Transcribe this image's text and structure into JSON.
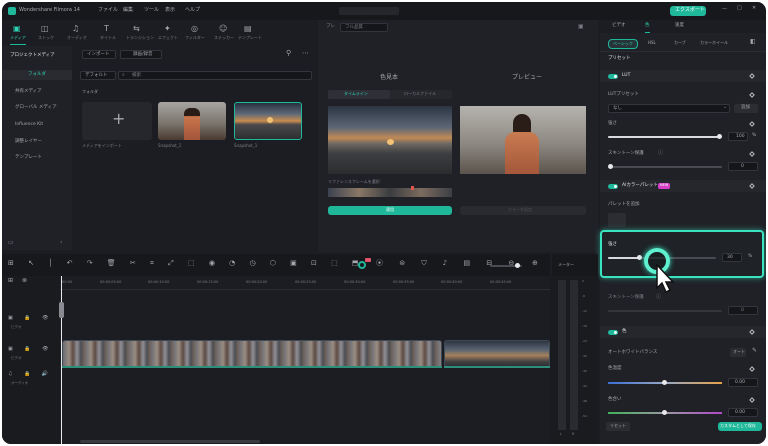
{
  "app": {
    "title": "Wondershare Filmora 14"
  },
  "menu": [
    "ファイル",
    "編集",
    "ツール",
    "表示",
    "ヘルプ"
  ],
  "export_label": "エクスポート",
  "toolbar": [
    "メディア",
    "ストック",
    "オーディオ",
    "タイトル",
    "トランジション",
    "エフェクト",
    "フィルター",
    "ステッカー",
    "テンプレート"
  ],
  "sidebar": {
    "items": [
      "プロジェクトメディア",
      "フォルダ",
      "共有メディア",
      "グローバル メディア",
      "Influence Kit",
      "調整レイヤー",
      "テンプレート"
    ]
  },
  "media": {
    "import_label": "インポート",
    "record_label": "録画/録音",
    "sort_label": "デフォルト",
    "search_placeholder": "検索",
    "folder_label": "フォルダ",
    "import_tile_label": "メディアをインポート",
    "thumbs": [
      "Snapshot_1",
      "Snapshot_1",
      "Snapshot_1"
    ]
  },
  "player": {
    "player_label": "プレ",
    "quality_label": "フル品質",
    "compare_title": "色見本",
    "preview_title": "プレビュー",
    "tab_timeline": "タイムライン",
    "tab_local": "ローカルファイル",
    "frame_select_label": "リファレンスフレームを選択",
    "apply_label": "適用",
    "disabled_label": "カラーを設定"
  },
  "timeline": {
    "meter_label": "メーター",
    "times": [
      "00:00",
      "00:00:05:00",
      "00:00:10:00",
      "00:00:15:00",
      "00:00:20:00",
      "00:00:25:00",
      "00:00:30:00",
      "00:00:35:00",
      "00:00:40:00",
      "00:00:45:00"
    ],
    "track_labels": [
      "ビデオ",
      "ビデオ",
      "オーディオ"
    ],
    "meter_ticks": [
      "0",
      "-6",
      "-12",
      "-18",
      "-24",
      "-30",
      "-36",
      "-42",
      "-48",
      "-54"
    ],
    "meter_lr": [
      "L",
      "R"
    ]
  },
  "right_panel": {
    "tabs": [
      "ビデオ",
      "色",
      "速度"
    ],
    "subtabs": [
      "ベーシック",
      "HSL",
      "カーブ",
      "カラーホイール"
    ],
    "preset_header": "プリセット",
    "lut_label": "LUT",
    "lut_preset_label": "LUTプリセット",
    "lut_preset_value": "なし",
    "add_label": "追加",
    "strength_label": "強さ",
    "strength_value": "100",
    "strength_unit": "%",
    "skin_protect_label": "スキントーン保護",
    "skin_value": "0",
    "ai_palette_label": "AIカラーパレット",
    "ai_badge": "NEW",
    "palette_add_label": "パレットを追加",
    "popup_strength_label": "強さ",
    "popup_value": "30",
    "popup_unit": "%",
    "skin_protect2_label": "スキントーン保護",
    "skin2_value": "0",
    "color_section": "色",
    "awb_label": "オートホワイトバランス",
    "auto_label": "オート",
    "temp_label": "色温度",
    "temp_value": "0.00",
    "tint_label": "色合い",
    "tint_value": "0.00",
    "reset_label": "リセット",
    "save_custom_label": "カスタムとして保存"
  },
  "colors": {
    "accent": "#1fb89a",
    "highlight_ring": "#39e3c0"
  }
}
